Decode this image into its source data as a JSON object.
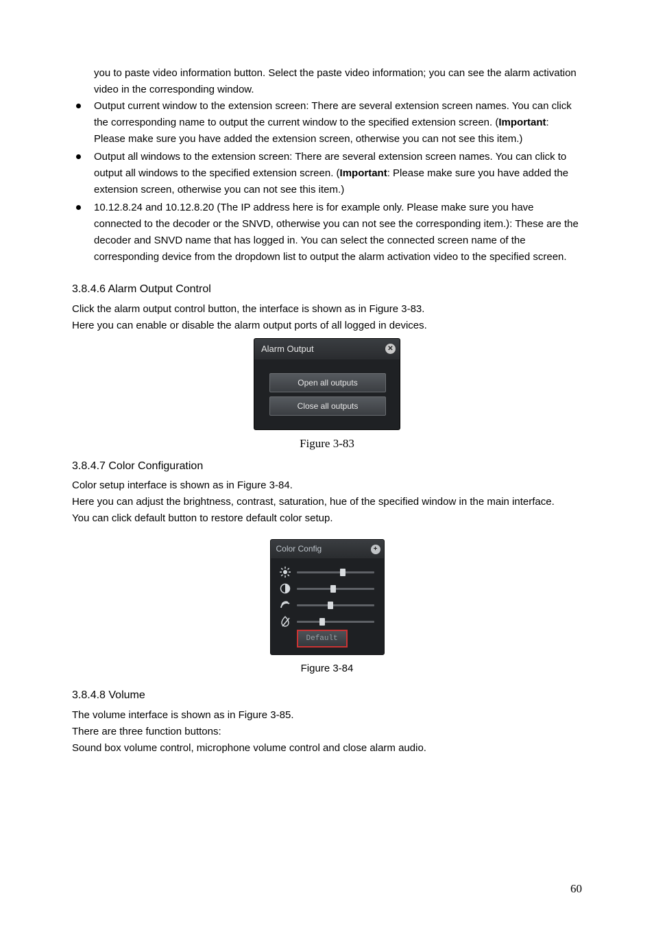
{
  "intro": [
    "you to paste video information button. Select the paste video information; you can see the alarm activation video in the corresponding window."
  ],
  "bullets": {
    "b1": {
      "lead": "Output current window to the extension screen: There are several extension screen names. You can click the corresponding name to output the current window to the specified extension screen. (",
      "imp": "Important",
      "tail": ": Please make sure you have added the extension screen, otherwise you can not see this item.)"
    },
    "b2": {
      "lead": "Output all windows to the extension screen: There are several extension screen names. You can click to output all windows to the specified extension screen. (",
      "imp": "Important",
      "tail": ": Please make sure you have added the extension screen, otherwise you can not see this item.)"
    },
    "b3": "10.12.8.24 and 10.12.8.20 (The IP address here is for example only. Please make sure you have connected to the decoder or the SNVD, otherwise you can not see the corresponding item.): These are the decoder and SNVD name that has logged in. You can select the connected screen name of the corresponding device from the dropdown list to output the alarm activation video to the specified screen."
  },
  "sec1": {
    "heading": "3.8.4.6  Alarm Output Control",
    "p1": "Click the alarm output control button, the interface is shown as in Figure 3-83.",
    "p2": "Here you can enable or disable the alarm output ports of all logged in devices.",
    "dlg_title": "Alarm Output",
    "btn_open": "Open all outputs",
    "btn_close": "Close all outputs",
    "caption": "Figure 3-83"
  },
  "sec2": {
    "heading": "3.8.4.7  Color Configuration",
    "p1": "Color setup interface is shown as in Figure 3-84.",
    "p2": "Here you can adjust the brightness, contrast, saturation, hue of the specified window in the main interface.",
    "p3": "You can click default button to restore default color setup.",
    "dlg_title": "Color Config",
    "sliders": {
      "brightness": {
        "pos": 56
      },
      "contrast": {
        "pos": 44
      },
      "saturation": {
        "pos": 40
      },
      "hue": {
        "pos": 30
      }
    },
    "default": "Default",
    "caption": "Figure 3-84"
  },
  "sec3": {
    "heading": "3.8.4.8  Volume",
    "p1": "The volume interface is shown as in Figure 3-85.",
    "p2": "There are three function buttons:",
    "p3": "Sound box volume control, microphone volume control and close alarm audio."
  },
  "page_number": "60"
}
